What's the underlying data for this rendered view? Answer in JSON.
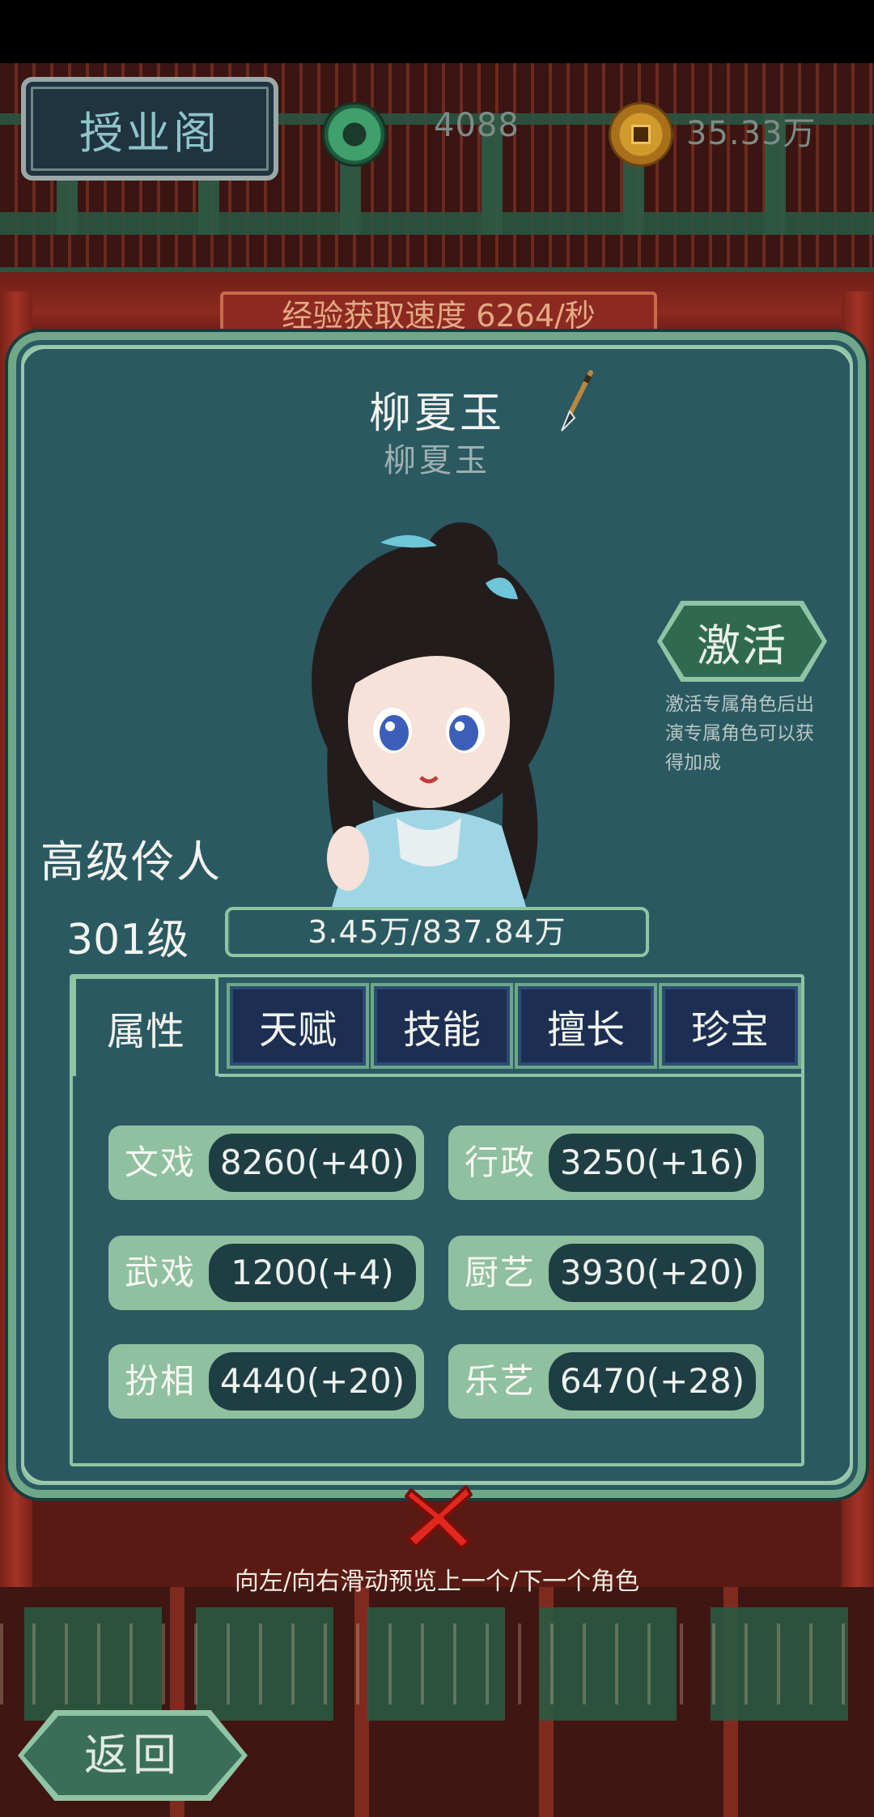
{
  "hud": {
    "title": "授业阁",
    "jade_currency": "4088",
    "gold_currency": "35.33万"
  },
  "exp_rate_banner": "经验获取速度 6264/秒",
  "character": {
    "name": "柳夏玉",
    "subtitle": "柳夏玉",
    "rank": "高级伶人",
    "level": "301级",
    "exp_text": "3.45万/837.84万",
    "exp_progress": 0.0041
  },
  "activate": {
    "label": "激活",
    "description": "激活专属角色后出演专属角色可以获得加成"
  },
  "tabs": [
    {
      "label": "属性",
      "active": true
    },
    {
      "label": "天赋",
      "active": false
    },
    {
      "label": "技能",
      "active": false
    },
    {
      "label": "擅长",
      "active": false
    },
    {
      "label": "珍宝",
      "active": false
    }
  ],
  "attributes": [
    {
      "label": "文戏",
      "value": "8260(+40)"
    },
    {
      "label": "行政",
      "value": "3250(+16)"
    },
    {
      "label": "武戏",
      "value": "1200(+4)"
    },
    {
      "label": "厨艺",
      "value": "3930(+20)"
    },
    {
      "label": "扮相",
      "value": "4440(+20)"
    },
    {
      "label": "乐艺",
      "value": "6470(+28)"
    }
  ],
  "swipe_hint": "向左/向右滑动预览上一个/下一个角色",
  "back_label": "返回",
  "icons": {
    "jade": "jade-coin-icon",
    "gold": "gold-coin-icon",
    "edit": "brush-icon",
    "close": "close-icon"
  },
  "colors": {
    "panel": "#2b5962",
    "border_green": "#8fc4a4",
    "close_red": "#e0281f"
  }
}
